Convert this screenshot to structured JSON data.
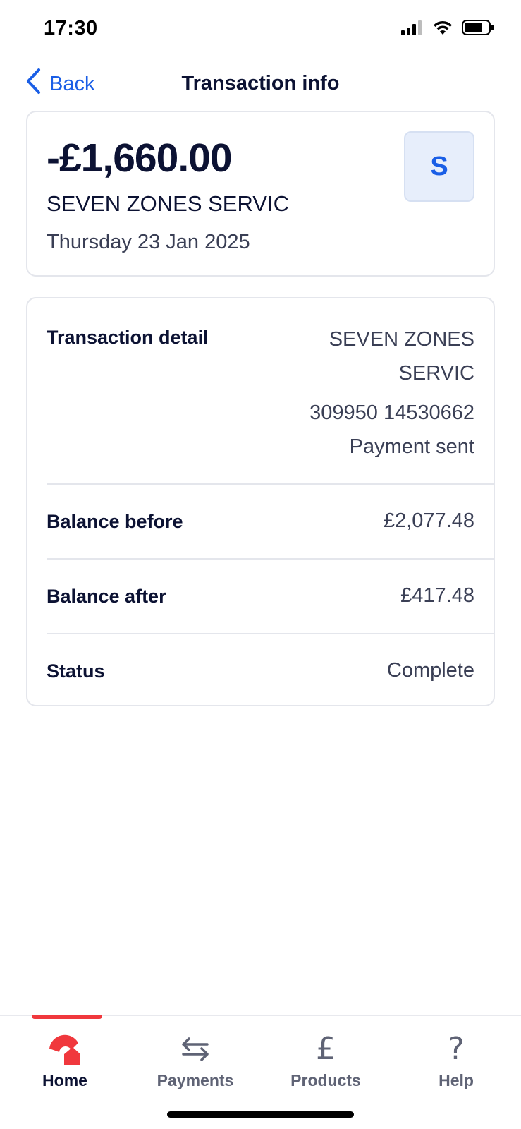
{
  "status_bar": {
    "time": "17:30"
  },
  "nav": {
    "back_label": "Back",
    "title": "Transaction info"
  },
  "summary": {
    "amount": "-£1,660.00",
    "merchant": "SEVEN ZONES SERVIC",
    "date": "Thursday 23 Jan 2025",
    "avatar_letter": "S"
  },
  "details": {
    "transaction_detail": {
      "label": "Transaction detail",
      "name_line1": "SEVEN ZONES",
      "name_line2": "SERVIC",
      "account": "309950 14530662",
      "type": "Payment sent"
    },
    "balance_before": {
      "label": "Balance before",
      "value": "£2,077.48"
    },
    "balance_after": {
      "label": "Balance after",
      "value": "£417.48"
    },
    "status": {
      "label": "Status",
      "value": "Complete"
    }
  },
  "tabs": [
    {
      "label": "Home",
      "icon": "home-icon",
      "active": true
    },
    {
      "label": "Payments",
      "icon": "transfer-arrows-icon",
      "active": false
    },
    {
      "label": "Products",
      "icon": "pound-icon",
      "active": false
    },
    {
      "label": "Help",
      "icon": "question-mark-icon",
      "active": false
    }
  ],
  "colors": {
    "accent_blue": "#1a5ee6",
    "brand_red": "#f0383d",
    "text_dark": "#0c1233",
    "text_muted": "#3a3f55",
    "border": "#e4e6ec"
  }
}
